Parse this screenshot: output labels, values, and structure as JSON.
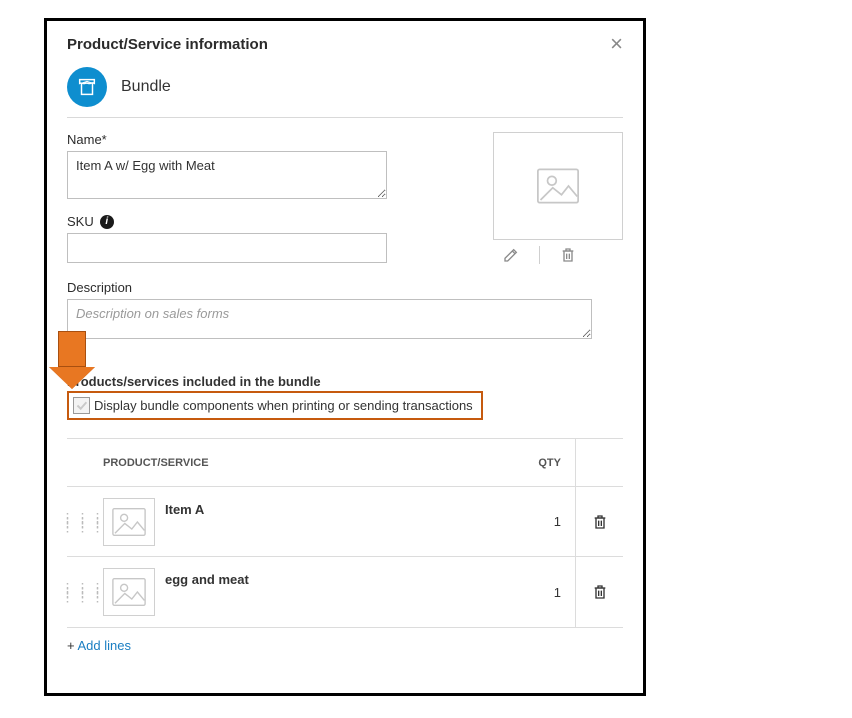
{
  "dialog": {
    "title": "Product/Service information",
    "type_label": "Bundle"
  },
  "fields": {
    "name_label": "Name*",
    "name_value": "Item A w/ Egg with Meat",
    "sku_label": "SKU",
    "sku_value": "",
    "desc_label": "Description",
    "desc_placeholder": "Description on sales forms",
    "desc_value": ""
  },
  "bundle": {
    "section_title": "Products/services included in the bundle",
    "display_components_label": "Display bundle components when printing or sending transactions",
    "col_product": "PRODUCT/SERVICE",
    "col_qty": "QTY",
    "rows": [
      {
        "name": "Item A",
        "qty": "1"
      },
      {
        "name": "egg and meat",
        "qty": "1"
      }
    ],
    "add_lines_label": "Add lines",
    "add_lines_prefix": "+ "
  }
}
